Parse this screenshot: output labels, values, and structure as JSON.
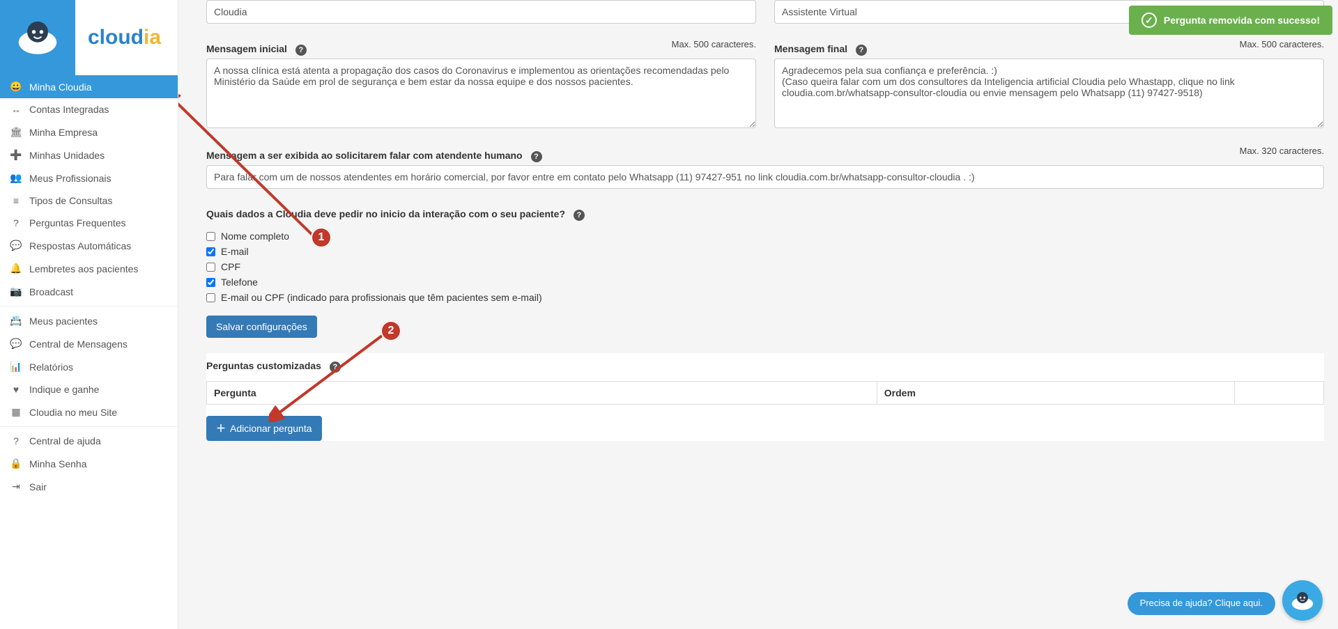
{
  "logo": {
    "text_blue": "cloud",
    "text_yellow": "ia"
  },
  "toast": {
    "message": "Pergunta removida com sucesso!"
  },
  "sidebar": {
    "items": [
      {
        "label": "Minha Cloudia",
        "icon": "😀"
      },
      {
        "label": "Contas Integradas",
        "icon": "↔"
      },
      {
        "label": "Minha Empresa",
        "icon": "🏛"
      },
      {
        "label": "Minhas Unidades",
        "icon": "➕"
      },
      {
        "label": "Meus Profissionais",
        "icon": "👥"
      },
      {
        "label": "Tipos de Consultas",
        "icon": "≡"
      },
      {
        "label": "Perguntas Frequentes",
        "icon": "?"
      },
      {
        "label": "Respostas Automáticas",
        "icon": "💬"
      },
      {
        "label": "Lembretes aos pacientes",
        "icon": "🔔"
      },
      {
        "label": "Broadcast",
        "icon": "📷"
      },
      {
        "label": "Meus pacientes",
        "icon": "📇"
      },
      {
        "label": "Central de Mensagens",
        "icon": "💬"
      },
      {
        "label": "Relatórios",
        "icon": "📊"
      },
      {
        "label": "Indique e ganhe",
        "icon": "♥"
      },
      {
        "label": "Cloudia no meu Site",
        "icon": "▦"
      },
      {
        "label": "Central de ajuda",
        "icon": "?"
      },
      {
        "label": "Minha Senha",
        "icon": "🔒"
      },
      {
        "label": "Sair",
        "icon": "⇥"
      }
    ]
  },
  "form": {
    "nome_label": "",
    "nome_value": "Cloudia",
    "cargo_value": "Assistente Virtual",
    "msg_inicial_label": "Mensagem inicial",
    "msg_inicial_max": "Max. 500 caracteres.",
    "msg_inicial_value": "A nossa clínica está atenta a propagação dos casos do Coronavirus e implementou as orientações recomendadas pelo Ministério da Saúde em prol de segurança e bem estar da nossa equipe e dos nossos pacientes.",
    "msg_final_label": "Mensagem final",
    "msg_final_max": "Max. 500 caracteres.",
    "msg_final_value": "Agradecemos pela sua confiança e preferência. :)\n(Caso queira falar com um dos consultores da Inteligencia artificial Cloudia pelo Whastapp, clique no link cloudia.com.br/whatsapp-consultor-cloudia ou envie mensagem pelo Whatsapp (11) 97427-9518)",
    "msg_humano_label": "Mensagem a ser exibida ao solicitarem falar com atendente humano",
    "msg_humano_max": "Max. 320 caracteres.",
    "msg_humano_value": "Para falar com um de nossos atendentes em horário comercial, por favor entre em contato pelo Whatsapp (11) 97427-951 no link cloudia.com.br/whatsapp-consultor-cloudia . :)",
    "dados_label": "Quais dados a Cloudia deve pedir no inicio da interação com o seu paciente?",
    "checks": [
      {
        "label": "Nome completo",
        "checked": false
      },
      {
        "label": "E-mail",
        "checked": true
      },
      {
        "label": "CPF",
        "checked": false
      },
      {
        "label": "Telefone",
        "checked": true
      },
      {
        "label": "E-mail ou CPF (indicado para profissionais que têm pacientes sem e-mail)",
        "checked": false
      }
    ],
    "save_btn": "Salvar configurações"
  },
  "customQs": {
    "title": "Perguntas customizadas",
    "col_pergunta": "Pergunta",
    "col_ordem": "Ordem",
    "add_btn": "Adicionar pergunta"
  },
  "help": {
    "pill": "Precisa de ajuda? Clique aqui."
  },
  "annotations": {
    "b1": "1",
    "b2": "2"
  }
}
